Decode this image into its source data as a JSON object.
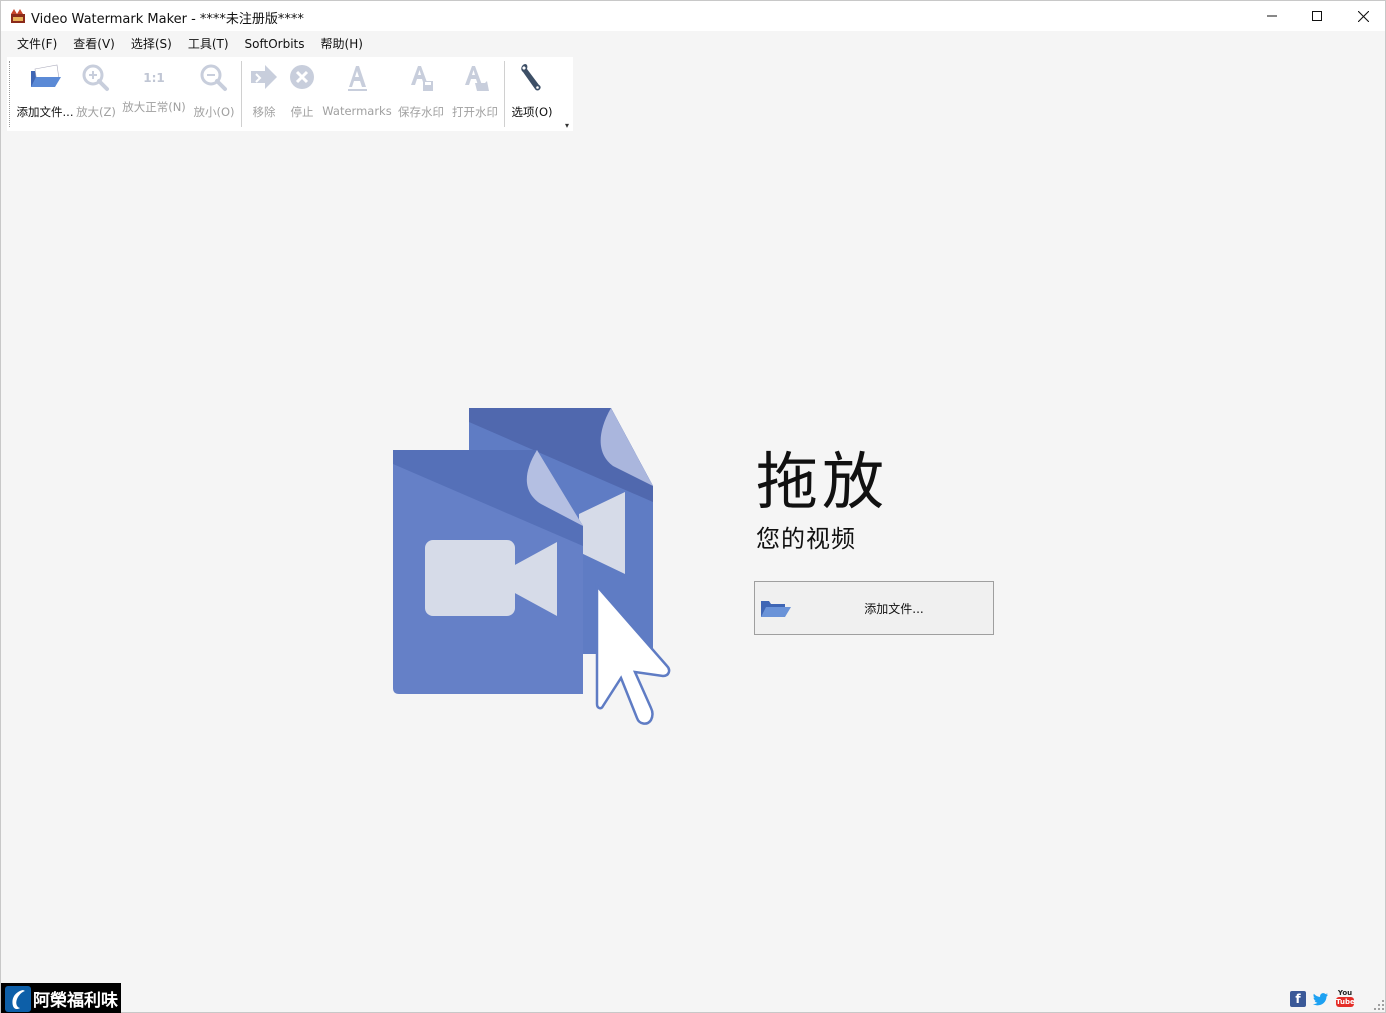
{
  "window": {
    "title": "Video Watermark Maker - ****未注册版****",
    "controls": {
      "minimize": "—",
      "maximize": "☐",
      "close": "✕"
    }
  },
  "menu": [
    {
      "label": "文件(F)"
    },
    {
      "label": "查看(V)"
    },
    {
      "label": "选择(S)"
    },
    {
      "label": "工具(T)"
    },
    {
      "label": "SoftOrbits"
    },
    {
      "label": "帮助(H)"
    }
  ],
  "toolbar": {
    "add_files": {
      "label": "添加文件...",
      "icon": "folder-open-icon",
      "enabled": true
    },
    "zoom_in": {
      "label": "放大(Z)",
      "icon": "zoom-in-icon",
      "enabled": false
    },
    "zoom_normal": {
      "label": "放大正常(N)",
      "icon": "one-to-one-icon",
      "icon_text": "1:1",
      "enabled": false
    },
    "zoom_out": {
      "label": "放小(O)",
      "icon": "zoom-out-icon",
      "enabled": false
    },
    "remove": {
      "label": "移除",
      "icon": "remove-arrow-icon",
      "enabled": false
    },
    "stop": {
      "label": "停止",
      "icon": "stop-icon",
      "enabled": false
    },
    "watermarks": {
      "label": "Watermarks",
      "icon": "text-a-icon",
      "enabled": false
    },
    "save_watermark": {
      "label": "保存水印",
      "icon": "save-watermark-icon",
      "enabled": false
    },
    "open_watermark": {
      "label": "打开水印",
      "icon": "open-watermark-icon",
      "enabled": false
    },
    "options": {
      "label": "选项(O)",
      "icon": "wrench-icon",
      "enabled": true
    },
    "overflow": "▾"
  },
  "main": {
    "drop_title": "拖放",
    "drop_subtitle": "您的视频",
    "add_files_button": "添加文件..."
  },
  "badge": {
    "text": "阿榮福利味"
  },
  "social": [
    {
      "name": "facebook",
      "glyph": "f"
    },
    {
      "name": "twitter",
      "glyph": "t"
    },
    {
      "name": "youtube",
      "glyph": "You Tube"
    }
  ],
  "colors": {
    "doc_blue": "#5f7cc4",
    "doc_dark": "#5068ae",
    "doc_fold": "#aab6dd",
    "camera": "#d6dbe8",
    "folder": "#4f76c4"
  }
}
